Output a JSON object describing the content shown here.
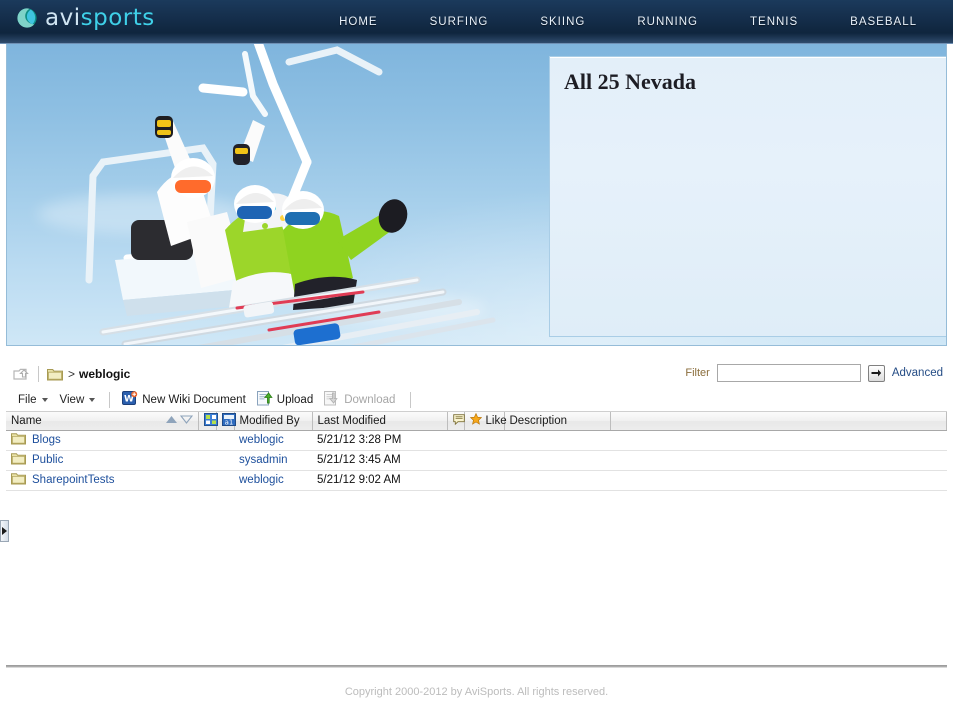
{
  "header": {
    "brand": {
      "part1": "avi",
      "part2": "sports",
      "logo_icon": "avisports-circle-logo"
    },
    "nav": [
      {
        "label": "HOME",
        "name": "nav-home"
      },
      {
        "label": "SURFING",
        "name": "nav-surfing"
      },
      {
        "label": "SKIING",
        "name": "nav-skiing"
      },
      {
        "label": "RUNNING",
        "name": "nav-running"
      },
      {
        "label": "TENNIS",
        "name": "nav-tennis"
      },
      {
        "label": "BASEBALL",
        "name": "nav-baseball"
      }
    ]
  },
  "hero": {
    "image_alt": "Three skiers riding a chairlift against a blue sky",
    "panel_title": "All 25 Nevada"
  },
  "doclib": {
    "breadcrumb": {
      "upload_icon": "upload-to-parent-icon",
      "folder_icon": "folder-icon",
      "separator": ">",
      "current": "weblogic"
    },
    "filter": {
      "label": "Filter",
      "value": "",
      "placeholder": "",
      "go_icon": "arrow-right-icon",
      "advanced_label": "Advanced"
    },
    "toolbar": {
      "file_menu": "File",
      "view_menu": "View",
      "new_wiki_document": "New Wiki Document",
      "upload": "Upload",
      "download": "Download",
      "download_disabled": true
    },
    "columns": [
      {
        "label": "Name",
        "name": "col-name"
      },
      {
        "label": "Modified By",
        "name": "col-modified-by"
      },
      {
        "label": "Last Modified",
        "name": "col-last-modified"
      },
      {
        "label": "",
        "name": "col-comments"
      },
      {
        "label": "Like",
        "name": "col-like"
      },
      {
        "label": "Description",
        "name": "col-description"
      },
      {
        "label": "",
        "name": "col-spacer"
      }
    ],
    "header_icons": {
      "sort_asc": "sort-ascending-icon",
      "sort_desc": "sort-descending-icon",
      "detach": "detach-table-icon",
      "query": "query-by-example-icon",
      "comments": "comment-icon",
      "like": "star-icon"
    },
    "rows": [
      {
        "icon": "folder-icon",
        "name": "Blogs",
        "modified_by": "weblogic",
        "last_modified": "5/21/12 3:28 PM",
        "description": ""
      },
      {
        "icon": "folder-icon",
        "name": "Public",
        "modified_by": "sysadmin",
        "last_modified": "5/21/12 3:45 AM",
        "description": ""
      },
      {
        "icon": "folder-icon",
        "name": "SharepointTests",
        "modified_by": "weblogic",
        "last_modified": "5/21/12 9:02 AM",
        "description": ""
      }
    ],
    "side_tab_icon": "expand-panel-arrow-icon"
  },
  "footer": {
    "copyright": "Copyright 2000-2012 by AviSports. All rights reserved."
  },
  "colors": {
    "header_dark": "#102740",
    "brand_cyan": "#3fd0e8",
    "link_blue": "#1d4f9c",
    "panel_blue": "#e3eff9",
    "filter_label": "#8a6d3b"
  }
}
